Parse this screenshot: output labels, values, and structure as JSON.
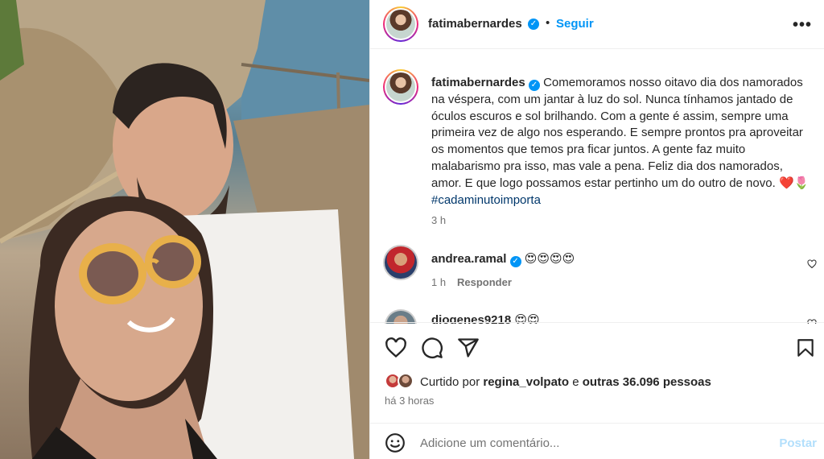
{
  "post": {
    "username": "fatimabernardes",
    "separator": "•",
    "follow_label": "Seguir",
    "more_label": "•••",
    "caption": "Comemoramos nosso oitavo dia dos namorados na véspera, com um jantar à luz do sol. Nunca tínhamos jantado de óculos escuros e sol brilhando. Com a gente é assim, sempre uma primeira vez de algo nos esperando. E sempre prontos pra aproveitar os momentos que temos pra ficar juntos. A gente faz muito malabarismo pra isso, mas vale a pena. Feliz dia dos namorados, amor. E que logo possamos estar pertinho um do outro de novo.",
    "caption_emojis": "❤️🌷",
    "hashtag": "#cadaminutoimporta",
    "caption_time": "3 h",
    "verified_mark": "✓"
  },
  "comments": [
    {
      "username": "andrea.ramal",
      "text": "😍😍😍😍",
      "time": "1 h",
      "reply_label": "Responder"
    },
    {
      "username": "diogenes9218",
      "text": "😍😍"
    }
  ],
  "likes": {
    "prefix": "Curtido por",
    "liker": "regina_volpato",
    "connector": "e",
    "others": "outras 36.096 pessoas"
  },
  "posted_ago": "há 3 horas",
  "composer": {
    "placeholder": "Adicione um comentário...",
    "post_label": "Postar"
  },
  "colors": {
    "accent": "#0095f6",
    "post_disabled": "#b2dffc",
    "hashtag": "#00376b",
    "muted": "#737373"
  },
  "icons": [
    "heart-icon",
    "comment-icon",
    "share-icon",
    "bookmark-icon",
    "smiley-icon",
    "more-icon",
    "verified-icon"
  ]
}
